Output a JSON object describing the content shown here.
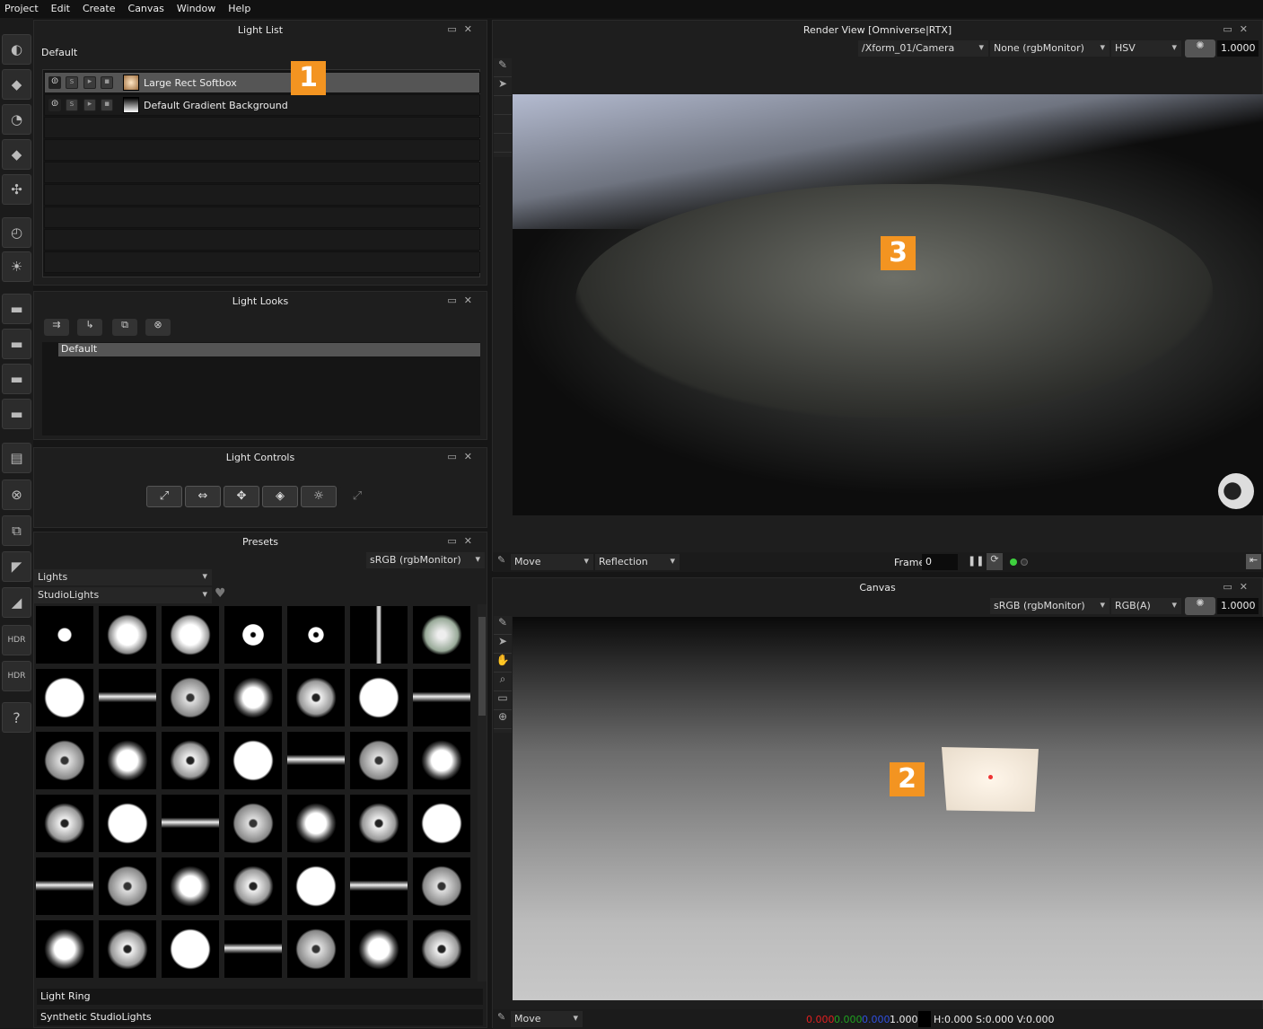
{
  "menu": [
    "Project",
    "Edit",
    "Create",
    "Canvas",
    "Window",
    "Help"
  ],
  "toolbar_icons": [
    "area-light-icon",
    "rect-light-icon",
    "spot-light-icon",
    "diamond-light-icon",
    "multi-light-icon",
    "dial-light-icon",
    "sun-light-icon",
    "strip-light-1-icon",
    "strip-light-2-icon",
    "strip-light-3-icon",
    "strip-light-4-icon",
    "layout-icon",
    "close-circle-icon",
    "duplicate-icon",
    "arrow-1-icon",
    "arrow-2-icon",
    "hdr-icon",
    "hdr-rotate-icon",
    "help-icon"
  ],
  "toolbar_text": {
    "hdr": "HDR",
    "help": "?"
  },
  "light_list": {
    "title": "Light List",
    "group": "Default",
    "items": [
      {
        "name": "Large Rect Softbox",
        "selected": true
      },
      {
        "name": "Default Gradient Background",
        "selected": false
      }
    ]
  },
  "light_looks": {
    "title": "Light Looks",
    "items": [
      "Default"
    ]
  },
  "light_controls": {
    "title": "Light Controls",
    "buttons": [
      "scale",
      "move-horizontal",
      "move-all",
      "rotate",
      "brightness",
      "expand"
    ]
  },
  "presets": {
    "title": "Presets",
    "colorspace": "sRGB (rgbMonitor)",
    "category": "Lights",
    "subcategory": "StudioLights",
    "footer": [
      "Light Ring",
      "Synthetic StudioLights"
    ]
  },
  "render_view": {
    "title": "Render View [Omniverse|RTX]",
    "camera": "/Xform_01/Camera",
    "display": "None (rgbMonitor)",
    "mode": "HSV",
    "exposure": "1.0000",
    "move_mode": "Move",
    "pick_mode": "Reflection",
    "frame_label": "Frame",
    "frame": "0"
  },
  "canvas": {
    "title": "Canvas",
    "colorspace": "sRGB (rgbMonitor)",
    "channels": "RGB(A)",
    "exposure": "1.0000",
    "move_mode": "Move",
    "r": "0.000",
    "g": "0.000",
    "b": "0.000",
    "a": "1.000",
    "hsv": "H:0.000 S:0.000 V:0.000"
  },
  "callouts": [
    "1",
    "2",
    "3"
  ],
  "colors": {
    "accent": "#f39421",
    "selected_row": "#555555",
    "panel": "#1e1e1e"
  }
}
